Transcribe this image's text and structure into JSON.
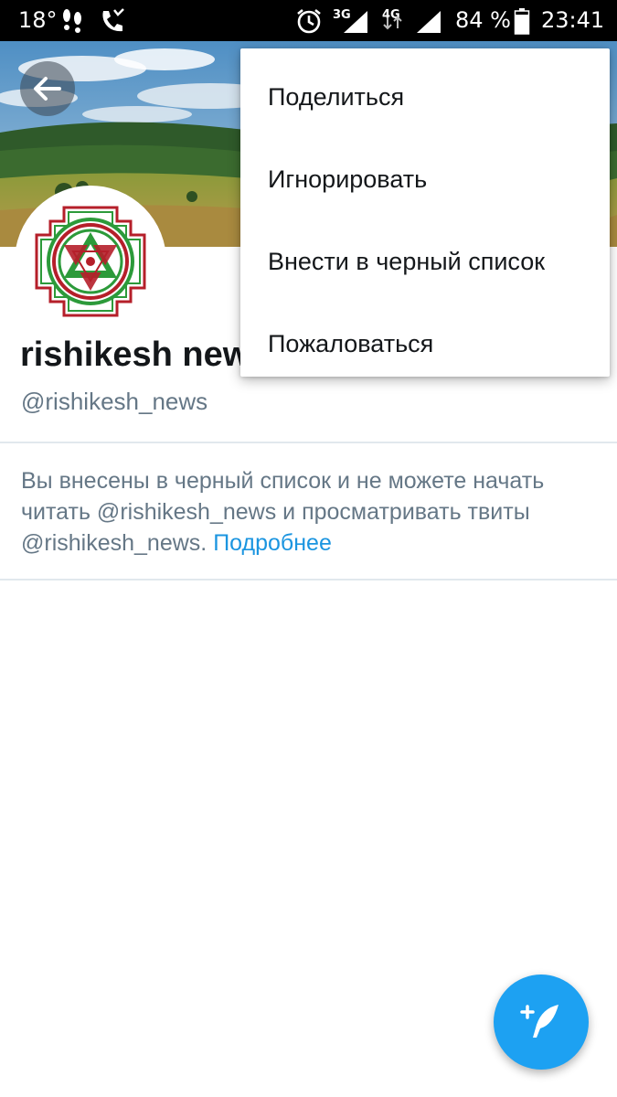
{
  "status_bar": {
    "temperature": "18°",
    "net_3g": "3G",
    "net_4g": "4G",
    "battery_percent": "84 %",
    "battery_level": 0.84,
    "time": "23:41",
    "icons": [
      "footsteps-icon",
      "missed-call-icon",
      "alarm-icon",
      "signal-3g-icon",
      "signal-4g-icon",
      "battery-icon"
    ]
  },
  "header": {
    "back_icon": "arrow-left-icon"
  },
  "profile": {
    "name": "rishikesh news",
    "handle": "@rishikesh_news"
  },
  "blocked_notice": {
    "text": "Вы внесены в черный список и не можете начать читать @rishikesh_news и просматривать твиты @rishikesh_news.",
    "link_label": "Подробнее"
  },
  "overflow_menu": {
    "items": [
      {
        "label": "Поделиться"
      },
      {
        "label": "Игнорировать"
      },
      {
        "label": "Внести в черный список"
      },
      {
        "label": "Пожаловаться"
      }
    ]
  },
  "fab": {
    "icon": "compose-tweet-icon"
  },
  "colors": {
    "accent": "#1da1f2",
    "link": "#1b95e0",
    "primary_text": "#14171a",
    "secondary_text": "#657786"
  }
}
